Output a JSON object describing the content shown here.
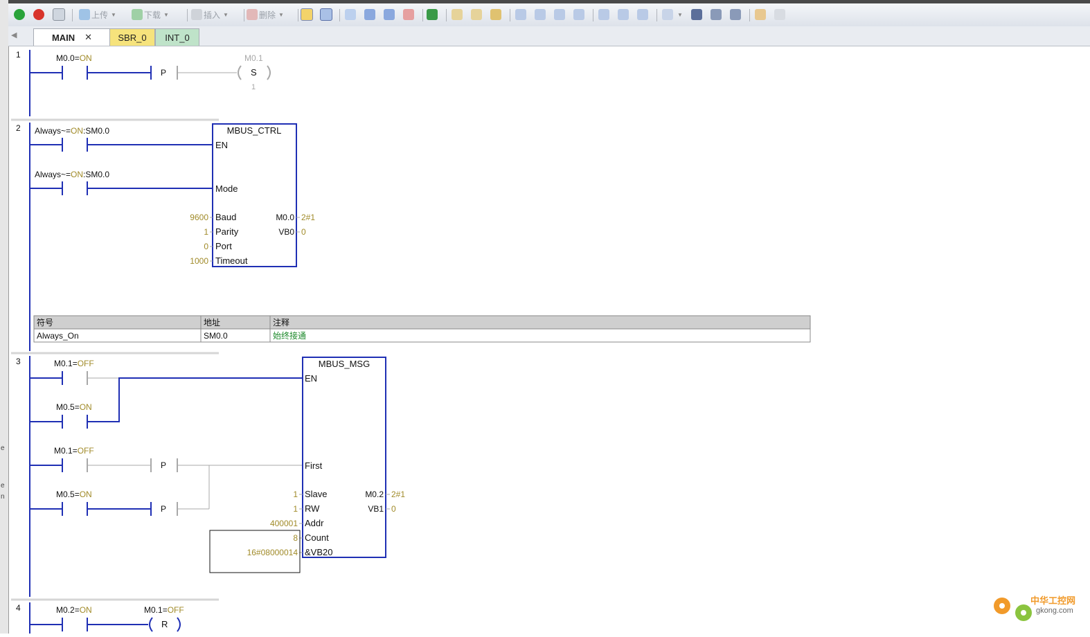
{
  "toolbar": {
    "upload_label": "上传",
    "download_label": "下载",
    "insert_label": "插入",
    "delete_label": "删除"
  },
  "tabs": [
    {
      "label": "MAIN",
      "active": true,
      "color": "#ffffff"
    },
    {
      "label": "SBR_0",
      "active": false,
      "color": "#f6e37c"
    },
    {
      "label": "INT_0",
      "active": false,
      "color": "#bfe3c9"
    }
  ],
  "colors": {
    "rail": "#1f2fb4",
    "inactive": "#a8a8a8",
    "status": "#a08a28",
    "text": "#111111"
  },
  "networks": [
    {
      "number": "1",
      "contact": {
        "operand": "M0.0",
        "eq": "=",
        "state": "ON"
      },
      "edge": "P",
      "coil": {
        "operand": "M0.1",
        "op": "S",
        "count": "1"
      }
    },
    {
      "number": "2",
      "contacts": [
        {
          "symbol": "Always",
          "mark": "~=",
          "state": "ON",
          "address": ":SM0.0"
        },
        {
          "symbol": "Always",
          "mark": "~=",
          "state": "ON",
          "address": ":SM0.0"
        }
      ],
      "box": {
        "title": "MBUS_CTRL",
        "inputs": [
          {
            "pin": "EN",
            "value": ""
          },
          {
            "pin": "Mode",
            "value": ""
          },
          {
            "pin": "Baud",
            "value": "9600"
          },
          {
            "pin": "Parity",
            "value": "1"
          },
          {
            "pin": "Port",
            "value": "0"
          },
          {
            "pin": "Timeout",
            "value": "1000"
          }
        ],
        "outputs": [
          {
            "pin": "M0.0",
            "value": "2#1"
          },
          {
            "pin": "VB0",
            "value": "0"
          }
        ]
      },
      "symbol_table": {
        "headers": [
          "符号",
          "地址",
          "注释"
        ],
        "rows": [
          [
            "Always_On",
            "SM0.0",
            "始终接通"
          ]
        ]
      }
    },
    {
      "number": "3",
      "contacts": [
        {
          "operand": "M0.1",
          "eq": "=",
          "state": "OFF"
        },
        {
          "operand": "M0.5",
          "eq": "=",
          "state": "ON"
        },
        {
          "operand": "M0.1",
          "eq": "=",
          "state": "OFF"
        },
        {
          "operand": "M0.5",
          "eq": "=",
          "state": "ON"
        }
      ],
      "edges": [
        "P",
        "P"
      ],
      "box": {
        "title": "MBUS_MSG",
        "inputs": [
          {
            "pin": "EN",
            "value": ""
          },
          {
            "pin": "First",
            "value": ""
          },
          {
            "pin": "Slave",
            "value": "1"
          },
          {
            "pin": "RW",
            "value": "1"
          },
          {
            "pin": "Addr",
            "value": "400001"
          },
          {
            "pin": "Count",
            "value": "8"
          },
          {
            "pin": "&VB20",
            "value": "16#08000014"
          }
        ],
        "outputs": [
          {
            "pin": "M0.2",
            "value": "2#1"
          },
          {
            "pin": "VB1",
            "value": "0"
          }
        ]
      }
    },
    {
      "number": "4",
      "contact": {
        "operand": "M0.2",
        "eq": "=",
        "state": "ON"
      },
      "coil": {
        "operand": "M0.1",
        "eq": "=",
        "state": "OFF",
        "op": "R"
      }
    }
  ],
  "watermark": {
    "brand": "中华工控网",
    "url": "gkong.com"
  }
}
